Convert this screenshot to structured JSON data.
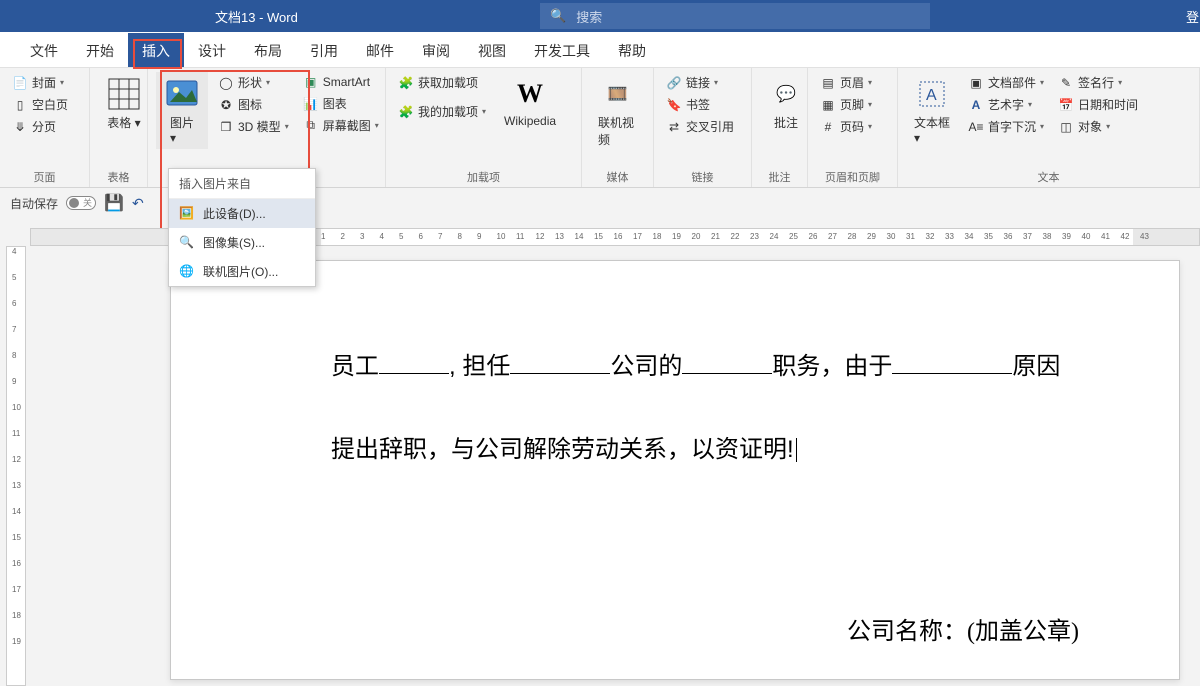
{
  "titlebar": {
    "title": "文档13  -  Word",
    "search_placeholder": "搜索",
    "login": "登"
  },
  "tabs": [
    "文件",
    "开始",
    "插入",
    "设计",
    "布局",
    "引用",
    "邮件",
    "审阅",
    "视图",
    "开发工具",
    "帮助"
  ],
  "active_tab_index": 2,
  "ribbon": {
    "pages": {
      "label": "页面",
      "cover": "封面",
      "blank": "空白页",
      "break": "分页"
    },
    "tables": {
      "label": "表格",
      "btn": "表格"
    },
    "illus": {
      "picture": "图片",
      "shapes": "形状",
      "icons": "图标",
      "model": "3D 模型",
      "smartart": "SmartArt",
      "chart": "图表",
      "screenshot": "屏幕截图"
    },
    "addins": {
      "label": "加载项",
      "get": "获取加载项",
      "my": "我的加载项",
      "wiki": "Wikipedia"
    },
    "media": {
      "label": "媒体",
      "video": "联机视频"
    },
    "links": {
      "label": "链接",
      "link": "链接",
      "bookmark": "书签",
      "crossref": "交叉引用"
    },
    "comments": {
      "label": "批注",
      "btn": "批注"
    },
    "hf": {
      "label": "页眉和页脚",
      "header": "页眉",
      "footer": "页脚",
      "pagenum": "页码"
    },
    "text": {
      "label": "文本",
      "textbox": "文本框",
      "parts": "文档部件",
      "wordart": "艺术字",
      "dropcap": "首字下沉",
      "sig": "签名行",
      "datetime": "日期和时间",
      "object": "对象"
    }
  },
  "dropdown": {
    "header": "插入图片来自",
    "items": [
      {
        "label": "此设备(D)...",
        "hover": true
      },
      {
        "label": "图像集(S)...",
        "hover": false
      },
      {
        "label": "联机图片(O)...",
        "hover": false
      }
    ]
  },
  "autosave": {
    "label": "自动保存",
    "state": "关"
  },
  "document": {
    "line1_pre": "员工",
    "line1_mid1": ", 担任",
    "line1_mid2": "公司的",
    "line1_mid3": "职务，由于",
    "line1_end": "原因",
    "line2": "提出辞职，与公司解除劳动关系，以资证明!",
    "footer": "公司名称：(加盖公章)"
  }
}
